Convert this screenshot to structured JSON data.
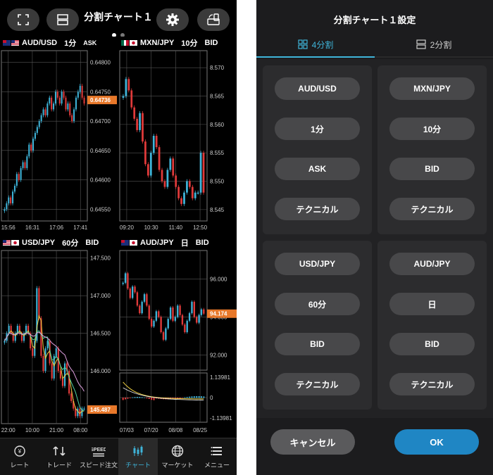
{
  "left": {
    "title": "分割チャート１",
    "page_dots": 2,
    "active_dot": 0,
    "panels": [
      {
        "symbol": "AUD/USD",
        "timeframe": "1分",
        "side": "ASK",
        "flags": [
          "au",
          "us"
        ],
        "y_ticks": [
          "0.64800",
          "0.64750",
          "0.64700",
          "0.64650",
          "0.64600",
          "0.64550"
        ],
        "x_ticks": [
          "15:56",
          "16:31",
          "17:06",
          "17:41"
        ],
        "price_tag": "0.64736",
        "ymin": 0.6453,
        "ymax": 0.6482,
        "last": 0.64736,
        "candles": [
          0.6455,
          0.6456,
          0.6457,
          0.6456,
          0.6458,
          0.6459,
          0.6461,
          0.646,
          0.6462,
          0.6463,
          0.6462,
          0.6464,
          0.6466,
          0.6465,
          0.6467,
          0.6468,
          0.6469,
          0.647,
          0.6471,
          0.6472,
          0.6471,
          0.6473,
          0.6474,
          0.6472,
          0.6473,
          0.6475,
          0.6474,
          0.6473,
          0.6475,
          0.6474,
          0.6472,
          0.6473,
          0.6471,
          0.647,
          0.6472,
          0.6474,
          0.6475,
          0.6476,
          0.6474,
          0.6473
        ],
        "indicator": false
      },
      {
        "symbol": "MXN/JPY",
        "timeframe": "10分",
        "side": "BID",
        "flags": [
          "mx",
          "jp"
        ],
        "y_ticks": [
          "8.570",
          "8.565",
          "8.560",
          "8.555",
          "8.550",
          "8.545"
        ],
        "x_ticks": [
          "09:20",
          "10:30",
          "11:40",
          "12:50"
        ],
        "price_tag": "",
        "ymin": 8.543,
        "ymax": 8.573,
        "last": 8.548,
        "candles": [
          8.565,
          8.568,
          8.566,
          8.563,
          8.561,
          8.559,
          8.562,
          8.557,
          8.553,
          8.551,
          8.555,
          8.558,
          8.556,
          8.552,
          8.55,
          8.549,
          8.552,
          8.554,
          8.551,
          8.549,
          8.547,
          8.546,
          8.548,
          8.55,
          8.549,
          8.547,
          8.548,
          8.548,
          8.555,
          8.548
        ],
        "indicator": false
      },
      {
        "symbol": "USD/JPY",
        "timeframe": "60分",
        "side": "BID",
        "flags": [
          "us",
          "jp"
        ],
        "y_ticks": [
          "147.500",
          "147.000",
          "146.500",
          "146.000"
        ],
        "x_ticks": [
          "22:00",
          "10:00",
          "21:00",
          "08:00"
        ],
        "price_tag": "145.487",
        "ymin": 145.3,
        "ymax": 147.6,
        "last": 145.487,
        "candles": [
          146.4,
          146.5,
          146.6,
          146.5,
          146.4,
          146.5,
          146.6,
          146.5,
          146.4,
          146.5,
          146.6,
          146.5,
          146.3,
          146.2,
          146.4,
          147.1,
          146.7,
          146.2,
          146.0,
          146.3,
          146.4,
          146.1,
          145.9,
          146.2,
          146.3,
          146.0,
          145.9,
          145.8,
          146.1,
          146.0,
          145.7,
          145.6,
          145.5,
          145.4,
          145.5,
          145.4,
          145.5,
          145.5
        ],
        "indicator": false
      },
      {
        "symbol": "AUD/JPY",
        "timeframe": "日",
        "side": "BID",
        "flags": [
          "au",
          "jp"
        ],
        "y_ticks": [
          "96.000",
          "94.000",
          "92.000"
        ],
        "x_ticks": [
          "07/03",
          "07/20",
          "08/08",
          "08/25"
        ],
        "sub_ticks": [
          "1.13981",
          "0",
          "-1.13981"
        ],
        "price_tag": "94.174",
        "ymin": 91.2,
        "ymax": 97.5,
        "last": 94.174,
        "candles": [
          95.8,
          96.3,
          95.5,
          95.0,
          95.6,
          95.3,
          94.6,
          94.2,
          94.8,
          95.2,
          94.6,
          93.9,
          93.5,
          93.8,
          94.3,
          94.0,
          93.2,
          92.8,
          93.4,
          93.9,
          94.5,
          93.8,
          94.0,
          94.6,
          94.1,
          93.6,
          93.2,
          93.8,
          94.2,
          94.8,
          94.0,
          93.7,
          94.1,
          94.4,
          94.174
        ],
        "indicator": true
      }
    ],
    "tabs": [
      {
        "label": "レート",
        "icon": "rate-icon"
      },
      {
        "label": "トレード",
        "icon": "trade-icon"
      },
      {
        "label": "スピード注文",
        "icon": "speed-order-icon",
        "badge": "SPEED"
      },
      {
        "label": "チャート",
        "icon": "chart-icon"
      },
      {
        "label": "マーケット",
        "icon": "market-icon"
      },
      {
        "label": "メニュー",
        "icon": "menu-icon"
      }
    ],
    "active_tab": 3
  },
  "right": {
    "title": "分割チャート１設定",
    "tabs": [
      {
        "label": "4分割",
        "icon": "grid-4-icon"
      },
      {
        "label": "2分割",
        "icon": "grid-2-icon"
      }
    ],
    "active_tab": 0,
    "cards": [
      {
        "symbol": "AUD/USD",
        "timeframe": "1分",
        "side": "ASK",
        "technical": "テクニカル"
      },
      {
        "symbol": "MXN/JPY",
        "timeframe": "10分",
        "side": "BID",
        "technical": "テクニカル"
      },
      {
        "symbol": "USD/JPY",
        "timeframe": "60分",
        "side": "BID",
        "technical": "テクニカル"
      },
      {
        "symbol": "AUD/JPY",
        "timeframe": "日",
        "side": "BID",
        "technical": "テクニカル"
      }
    ],
    "cancel_label": "キャンセル",
    "ok_label": "OK"
  },
  "colors": {
    "up": "#3fb4d9",
    "down": "#e03a3a",
    "accent": "#3fb4d9",
    "price_tag": "#e8782a",
    "ok": "#1f86c4"
  }
}
